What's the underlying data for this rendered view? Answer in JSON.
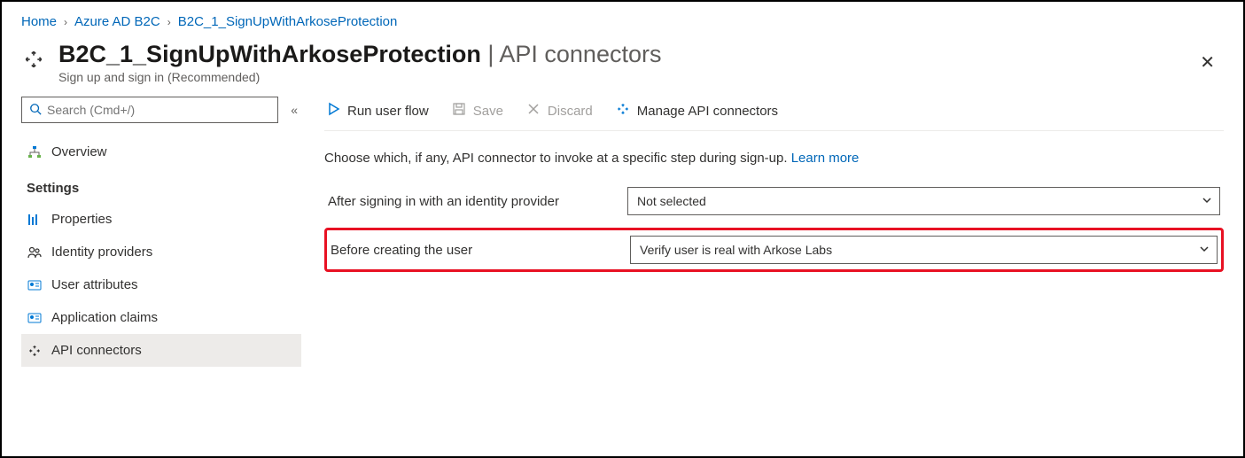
{
  "breadcrumb": {
    "home": "Home",
    "b2c": "Azure AD B2C",
    "flow": "B2C_1_SignUpWithArkoseProtection"
  },
  "header": {
    "title_main": "B2C_1_SignUpWithArkoseProtection",
    "title_sep": " | ",
    "title_sub": "API connectors",
    "subtitle": "Sign up and sign in (Recommended)"
  },
  "search": {
    "placeholder": "Search (Cmd+/)"
  },
  "sidebar": {
    "overview": "Overview",
    "section_settings": "Settings",
    "properties": "Properties",
    "identity_providers": "Identity providers",
    "user_attributes": "User attributes",
    "application_claims": "Application claims",
    "api_connectors": "API connectors"
  },
  "toolbar": {
    "run": "Run user flow",
    "save": "Save",
    "discard": "Discard",
    "manage": "Manage API connectors"
  },
  "main": {
    "intro": "Choose which, if any, API connector to invoke at a specific step during sign-up.",
    "learn_more": "Learn more",
    "row1_label": "After signing in with an identity provider",
    "row1_value": "Not selected",
    "row2_label": "Before creating the user",
    "row2_value": "Verify user is real with Arkose Labs"
  },
  "colors": {
    "link": "#0067b8",
    "highlight": "#e81123"
  }
}
